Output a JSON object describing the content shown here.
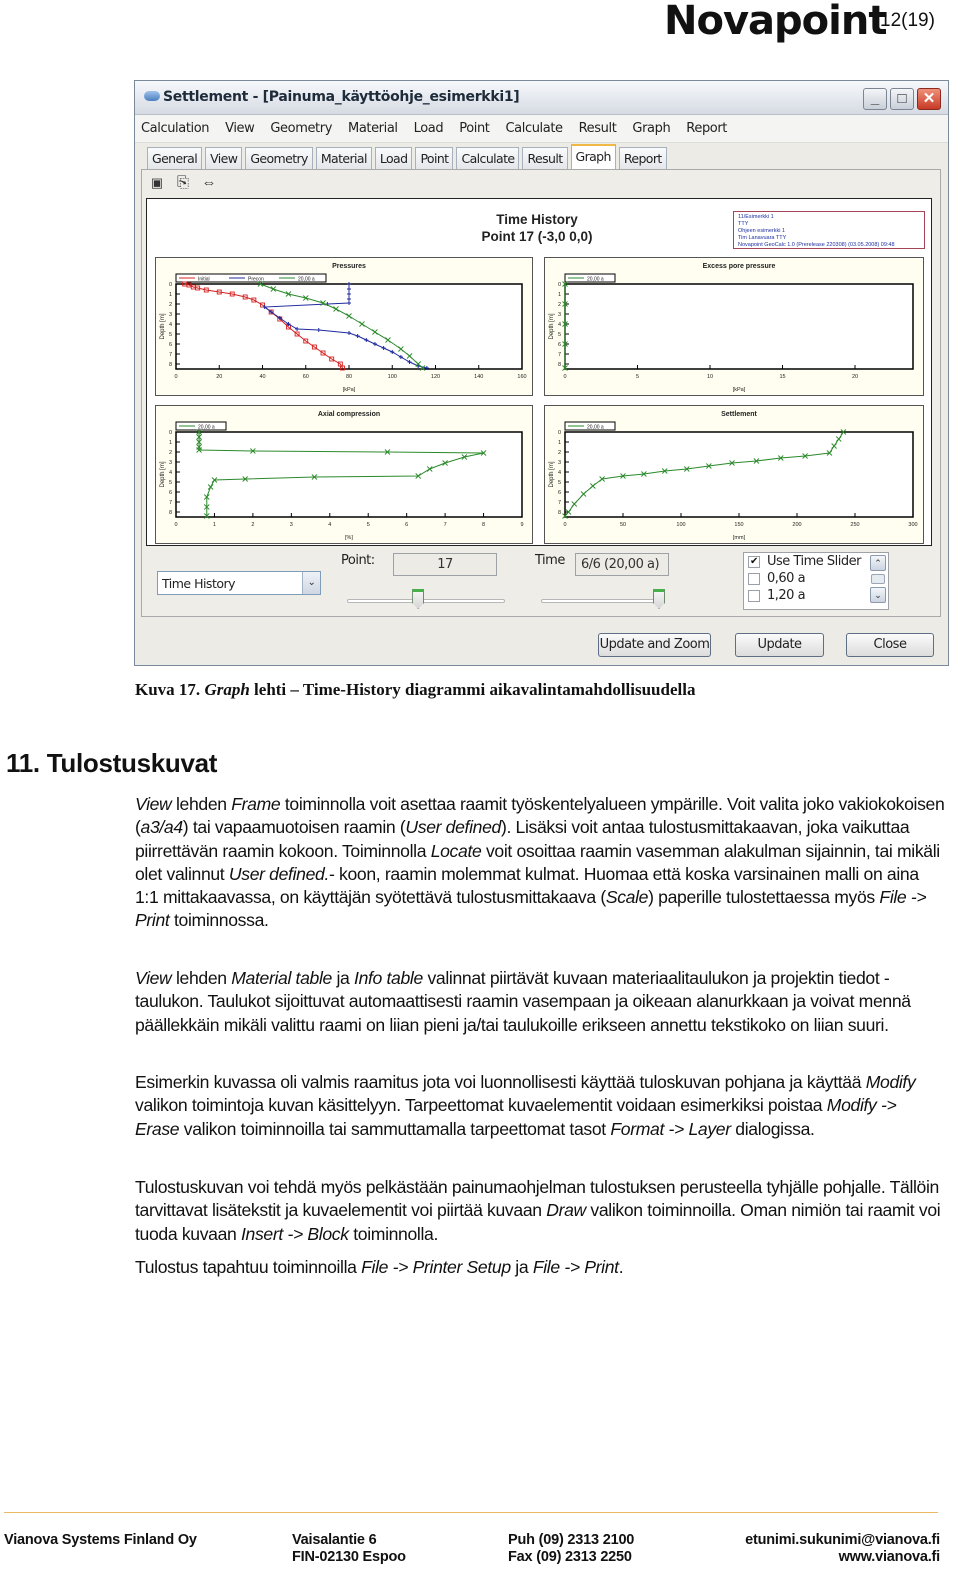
{
  "header": {
    "logo": "Novapoint",
    "page_number": "12(19)"
  },
  "window": {
    "title": "Settlement - [Painuma_käyttöohje_esimerkki1]",
    "controls": {
      "minimize": "_",
      "maximize": "□",
      "close": "✕"
    },
    "menu": [
      "Calculation",
      "View",
      "Geometry",
      "Material",
      "Load",
      "Point",
      "Calculate",
      "Result",
      "Graph",
      "Report"
    ],
    "tabs": [
      {
        "label": "General",
        "active": false
      },
      {
        "label": "View",
        "active": false
      },
      {
        "label": "Geometry",
        "active": false
      },
      {
        "label": "Material",
        "active": false
      },
      {
        "label": "Load",
        "active": false
      },
      {
        "label": "Point",
        "active": false
      },
      {
        "label": "Calculate",
        "active": false
      },
      {
        "label": "Result",
        "active": false
      },
      {
        "label": "Graph",
        "active": true
      },
      {
        "label": "Report",
        "active": false
      }
    ],
    "toolbar": [
      {
        "icon": "save-icon",
        "glyph": "💾"
      },
      {
        "icon": "copy-icon",
        "glyph": "⎘"
      },
      {
        "icon": "zoom-extents-icon",
        "glyph": "⇔"
      }
    ],
    "graph": {
      "title_line1": "Time History",
      "title_line2": "Point 17 (-3,0 0,0)",
      "info_box": [
        "11/Esimerkki 1",
        "TTY",
        "Ohjeen esimerkki 1",
        "Tim Lanavuara TTY",
        "Novapoint GeoCalc 1.0 (Prerelease 220308) (03.05.2008) 09:48"
      ]
    },
    "controls_panel": {
      "view_select": "Time History",
      "point_label": "Point:",
      "point_value": "17",
      "point_slider_fraction": 0.45,
      "time_label": "Time",
      "time_value": "6/6 (20,00 a)",
      "time_slider_fraction": 1.0,
      "time_list": [
        {
          "label": "Use Time Slider",
          "checked": true
        },
        {
          "label": "0,60 a",
          "checked": false
        },
        {
          "label": "1,20 a",
          "checked": false
        }
      ],
      "buttons": {
        "update_zoom": "Update and Zoom",
        "update": "Update",
        "close": "Close"
      }
    }
  },
  "chart_data": [
    {
      "type": "line",
      "title": "Pressures",
      "xlabel": "[kPa]",
      "ylabel": "Depth [m]",
      "xlim": [
        0,
        160
      ],
      "ylim": [
        0,
        8.5
      ],
      "y_inverted": true,
      "xticks": [
        0,
        20,
        40,
        60,
        80,
        100,
        120,
        140,
        160
      ],
      "yticks": [
        0,
        1,
        2,
        3,
        4,
        5,
        6,
        7,
        8
      ],
      "legend": "top-left",
      "series": [
        {
          "name": "Initial",
          "color": "#d42020",
          "marker": "square",
          "points": [
            [
              4,
              0
            ],
            [
              6,
              0.1
            ],
            [
              8,
              0.3
            ],
            [
              10,
              0.4
            ],
            [
              14,
              0.6
            ],
            [
              20,
              0.8
            ],
            [
              26,
              1.0
            ],
            [
              32,
              1.3
            ],
            [
              36,
              1.6
            ],
            [
              40,
              2.1
            ],
            [
              44,
              2.8
            ],
            [
              48,
              3.5
            ],
            [
              52,
              4.3
            ],
            [
              56,
              5.0
            ],
            [
              60,
              5.7
            ],
            [
              64,
              6.3
            ],
            [
              68,
              6.9
            ],
            [
              72,
              7.5
            ],
            [
              76,
              8.0
            ],
            [
              77,
              8.4
            ]
          ]
        },
        {
          "name": "Precon",
          "color": "#1f2a9e",
          "marker": "plus",
          "points": [
            [
              80,
              0
            ],
            [
              80,
              0.5
            ],
            [
              80,
              1.0
            ],
            [
              80,
              1.5
            ],
            [
              80,
              1.9
            ],
            [
              70,
              2.0
            ],
            [
              41,
              2.3
            ],
            [
              44,
              2.8
            ],
            [
              48,
              3.4
            ],
            [
              52,
              4.0
            ],
            [
              56,
              4.5
            ],
            [
              66,
              4.6
            ],
            [
              80,
              4.9
            ],
            [
              84,
              5.2
            ],
            [
              88,
              5.6
            ],
            [
              92,
              6.0
            ],
            [
              96,
              6.4
            ],
            [
              100,
              6.8
            ],
            [
              104,
              7.3
            ],
            [
              108,
              7.8
            ],
            [
              112,
              8.2
            ],
            [
              116,
              8.4
            ]
          ]
        },
        {
          "name": "20,00 a",
          "color": "#2a8a2a",
          "marker": "x",
          "points": [
            [
              39,
              0
            ],
            [
              45,
              0.5
            ],
            [
              52,
              1.0
            ],
            [
              60,
              1.4
            ],
            [
              68,
              1.9
            ],
            [
              74,
              2.5
            ],
            [
              80,
              3.2
            ],
            [
              86,
              4.0
            ],
            [
              92,
              4.8
            ],
            [
              98,
              5.6
            ],
            [
              104,
              6.5
            ],
            [
              108,
              7.2
            ],
            [
              112,
              8.0
            ],
            [
              114,
              8.4
            ]
          ]
        }
      ]
    },
    {
      "type": "line",
      "title": "Excess pore pressure",
      "xlabel": "[kPa]",
      "ylabel": "Depth [m]",
      "xlim": [
        0,
        24
      ],
      "ylim": [
        0,
        8.5
      ],
      "y_inverted": true,
      "xticks": [
        0,
        5,
        10,
        15,
        20
      ],
      "yticks": [
        0,
        1,
        2,
        3,
        4,
        5,
        6,
        7,
        8
      ],
      "legend": "top-left",
      "series": [
        {
          "name": "20,00 a",
          "color": "#2a8a2a",
          "marker": "x",
          "points": [
            [
              0,
              0
            ],
            [
              0,
              2
            ],
            [
              0,
              4
            ],
            [
              0,
              6
            ],
            [
              0,
              8.4
            ]
          ]
        }
      ]
    },
    {
      "type": "line",
      "title": "Axial compression",
      "xlabel": "[%]",
      "ylabel": "Depth [m]",
      "xlim": [
        0,
        9
      ],
      "ylim": [
        0,
        8.5
      ],
      "y_inverted": true,
      "xticks": [
        0,
        1,
        2,
        3,
        4,
        5,
        6,
        7,
        8,
        9
      ],
      "yticks": [
        0,
        1,
        2,
        3,
        4,
        5,
        6,
        7,
        8
      ],
      "legend": "top-left",
      "series": [
        {
          "name": "20,00 a",
          "color": "#2a8a2a",
          "marker": "x",
          "points": [
            [
              0.6,
              0
            ],
            [
              0.6,
              0.5
            ],
            [
              0.6,
              1.0
            ],
            [
              0.6,
              1.5
            ],
            [
              0.6,
              1.8
            ],
            [
              2.0,
              1.9
            ],
            [
              5.5,
              2.0
            ],
            [
              8.0,
              2.1
            ],
            [
              7.5,
              2.5
            ],
            [
              7.0,
              3.1
            ],
            [
              6.6,
              3.7
            ],
            [
              6.3,
              4.4
            ],
            [
              3.6,
              4.5
            ],
            [
              1.8,
              4.7
            ],
            [
              1.0,
              4.8
            ],
            [
              0.9,
              5.5
            ],
            [
              0.8,
              6.5
            ],
            [
              0.8,
              7.5
            ],
            [
              0.8,
              8.4
            ]
          ]
        }
      ]
    },
    {
      "type": "line",
      "title": "Settlement",
      "xlabel": "[mm]",
      "ylabel": "Depth [m]",
      "xlim": [
        0,
        300
      ],
      "ylim": [
        0,
        8.5
      ],
      "y_inverted": true,
      "xticks": [
        0,
        50,
        100,
        150,
        200,
        250,
        300
      ],
      "yticks": [
        0,
        1,
        2,
        3,
        4,
        5,
        6,
        7,
        8
      ],
      "legend": "top-left",
      "series": [
        {
          "name": "20,00 a",
          "color": "#2a8a2a",
          "marker": "x",
          "points": [
            [
              240,
              0
            ],
            [
              236,
              0.7
            ],
            [
              232,
              1.4
            ],
            [
              228,
              2.1
            ],
            [
              207,
              2.4
            ],
            [
              186,
              2.6
            ],
            [
              165,
              2.9
            ],
            [
              144,
              3.1
            ],
            [
              124,
              3.4
            ],
            [
              105,
              3.7
            ],
            [
              86,
              3.9
            ],
            [
              68,
              4.2
            ],
            [
              50,
              4.4
            ],
            [
              32,
              4.7
            ],
            [
              24,
              5.4
            ],
            [
              16,
              6.2
            ],
            [
              8,
              7.2
            ],
            [
              3,
              8.0
            ],
            [
              0,
              8.4
            ]
          ]
        }
      ]
    }
  ],
  "document": {
    "caption_prefix": "Kuva 17. ",
    "caption_italic": "Graph",
    "caption_rest": " lehti – Time-History diagrammi aikavalintamahdollisuudella",
    "heading": "11. Tulostuskuvat",
    "paragraphs": [
      [
        [
          "i",
          "View"
        ],
        [
          "t",
          " lehden "
        ],
        [
          "i",
          "Frame"
        ],
        [
          "t",
          " toiminnolla voit asettaa raamit työskentelyalueen ympärille. Voit valita joko vakiokokoisen ("
        ],
        [
          "i",
          "a3/a4"
        ],
        [
          "t",
          ") tai vapaamuotoisen raamin ("
        ],
        [
          "i",
          "User defined"
        ],
        [
          "t",
          "). Lisäksi voit antaa tulostusmittakaavan, joka vaikuttaa piirrettävän raamin kokoon. Toiminnolla "
        ],
        [
          "i",
          "Locate"
        ],
        [
          "t",
          " voit osoittaa raamin vasemman alakulman sijainnin, tai mikäli olet valinnut "
        ],
        [
          "i",
          "User defined."
        ],
        [
          "t",
          "- koon, raamin molemmat kulmat. Huomaa että koska varsinainen malli on aina 1:1 mittakaavassa, on käyttäjän syötettävä tulostusmittakaava ("
        ],
        [
          "i",
          "Scale"
        ],
        [
          "t",
          ") paperille tulostettaessa myös "
        ],
        [
          "i",
          "File -> Print"
        ],
        [
          "t",
          " toiminnossa."
        ]
      ],
      [
        [
          "i",
          "View"
        ],
        [
          "t",
          " lehden "
        ],
        [
          "i",
          "Material table"
        ],
        [
          "t",
          " ja "
        ],
        [
          "i",
          "Info table"
        ],
        [
          "t",
          " valinnat piirtävät kuvaan materiaalitaulukon ja projektin tiedot -taulukon. Taulukot sijoittuvat automaattisesti raamin vasempaan ja oikeaan alanurkkaan ja voivat mennä päällekkäin mikäli valittu raami on liian pieni ja/tai taulukoille erikseen annettu tekstikoko on liian suuri."
        ]
      ],
      [
        [
          "t",
          "Esimerkin kuvassa oli valmis raamitus jota voi luonnollisesti käyttää tuloskuvan pohjana ja käyttää "
        ],
        [
          "i",
          "Modify"
        ],
        [
          "t",
          " valikon toimintoja kuvan käsittelyyn. Tarpeettomat kuvaelementit voidaan esimerkiksi poistaa "
        ],
        [
          "i",
          "Modify -> Erase"
        ],
        [
          "t",
          " valikon toiminnoilla tai sammuttamalla tarpeettomat tasot "
        ],
        [
          "i",
          "Format -> Layer"
        ],
        [
          "t",
          " dialogissa."
        ]
      ],
      [
        [
          "t",
          "Tulostuskuvan voi tehdä myös pelkästään painumaohjelman tulostuksen perusteella tyhjälle pohjalle. Tällöin tarvittavat lisätekstit ja kuvaelementit voi piirtää kuvaan "
        ],
        [
          "i",
          "Draw"
        ],
        [
          "t",
          " valikon toiminnoilla. Oman nimiön tai raamit voi tuoda kuvaan "
        ],
        [
          "i",
          "Insert -> Block"
        ],
        [
          "t",
          " toiminnolla."
        ]
      ],
      [
        [
          "t",
          "Tulostus tapahtuu toiminnoilla "
        ],
        [
          "i",
          "File -> Printer Setup"
        ],
        [
          "t",
          " ja "
        ],
        [
          "i",
          "File -> Print"
        ],
        [
          "t",
          "."
        ]
      ]
    ]
  },
  "footer": {
    "company": "Vianova Systems Finland Oy",
    "address_1": "Vaisalantie 6",
    "address_2": "FIN-02130 Espoo",
    "phone": "Puh  (09) 2313 2100",
    "fax": "Fax  (09) 2313 2250",
    "email": "etunimi.sukunimi@vianova.fi",
    "web": "www.vianova.fi"
  }
}
